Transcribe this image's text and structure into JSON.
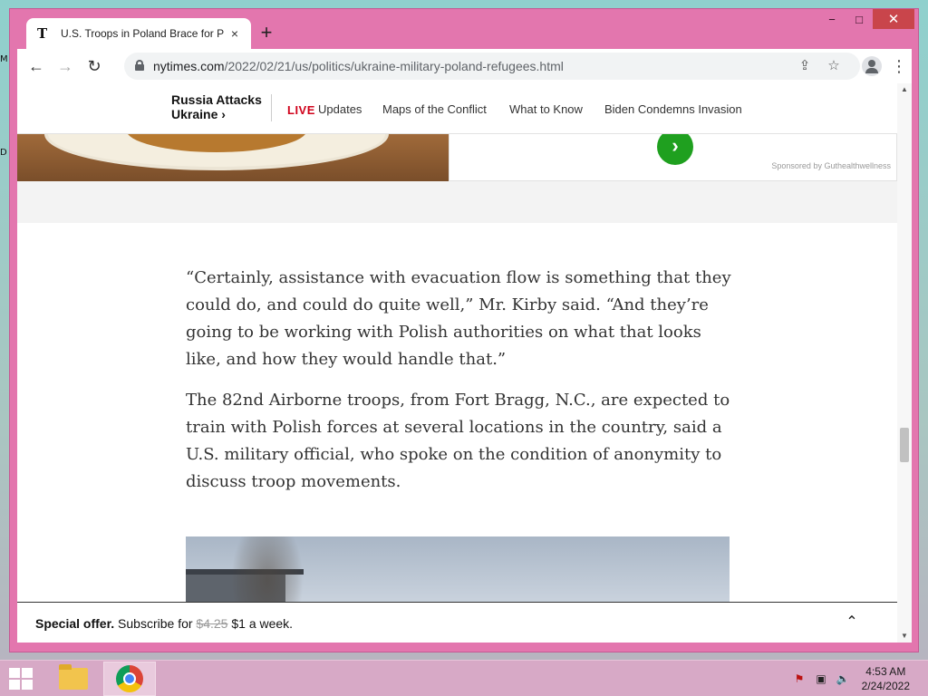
{
  "browser": {
    "tab_title": "U.S. Troops in Poland Brace for P",
    "tab_favicon": "T",
    "url_host": "nytimes.com",
    "url_path": "/2022/02/21/us/politics/ukraine-military-poland-refugees.html",
    "new_tab": "+",
    "tab_close": "×",
    "minimize": "−",
    "maximize": "□",
    "close": "✕",
    "back": "←",
    "forward": "→",
    "reload": "↻",
    "share": "⇪",
    "star": "☆",
    "menu": "⋮"
  },
  "nav": {
    "section_line1": "Russia Attacks",
    "section_line2": "Ukraine ›",
    "live_label": "LIVE",
    "links": [
      "Updates",
      "Maps of the Conflict",
      "What to Know",
      "Biden Condemns Invasion"
    ]
  },
  "ad": {
    "arrow": "›",
    "sponsor": "Sponsored by Guthealthwellness"
  },
  "article": {
    "paragraphs": [
      "“Certainly, assistance with evacuation flow is something that they could do, and could do quite well,” Mr. Kirby said. “And they’re going to be working with Polish authorities on what that looks like, and how they would handle that.”",
      "The 82nd Airborne troops, from Fort Bragg, N.C., are expected to train with Polish forces at several locations in the country, said a U.S. military official, who spoke on the condition of anonymity to discuss troop movements."
    ]
  },
  "offer": {
    "bold": "Special offer.",
    "text": "Subscribe for",
    "old_price": "$4.25",
    "new_price": "$1 a week.",
    "chevron": "⌃"
  },
  "taskbar": {
    "time": "4:53 AM",
    "date": "2/24/2022"
  },
  "desktop": {
    "frag_top": "M",
    "frag_mid": "D"
  },
  "colors": {
    "window_frame": "#e376ae",
    "live_red": "#d0021b",
    "ad_green": "#1fa01f"
  }
}
